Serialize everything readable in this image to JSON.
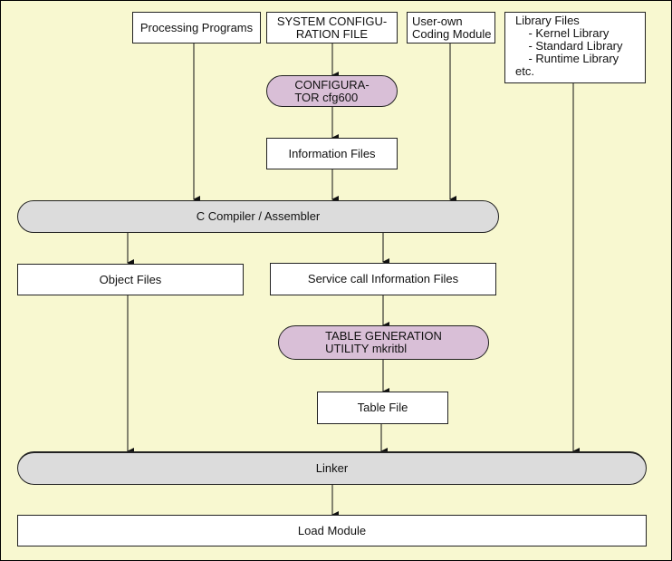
{
  "diagram": {
    "nodes": {
      "processing_programs": "Processing Programs",
      "system_config_file": "SYSTEM CONFIGU-\nRATION FILE",
      "user_own_module": "User-own\nCoding Module",
      "library_files": "Library Files\n    - Kernel Library\n    - Standard Library\n    - Runtime Library\netc.",
      "configurator": "CONFIGURA-\nTOR cfg600",
      "information_files": "Information Files",
      "c_compiler": "C Compiler / Assembler",
      "object_files": "Object Files",
      "service_call_info_files": "Service call Information Files",
      "table_generation_utility": "TABLE GENERATION\nUTILITY mkritbl",
      "table_file": "Table File",
      "linker": "Linker",
      "load_module": "Load Module"
    },
    "edges": [
      [
        "system_config_file",
        "configurator"
      ],
      [
        "configurator",
        "information_files"
      ],
      [
        "processing_programs",
        "c_compiler"
      ],
      [
        "information_files",
        "c_compiler"
      ],
      [
        "user_own_module",
        "c_compiler"
      ],
      [
        "c_compiler",
        "object_files"
      ],
      [
        "c_compiler",
        "service_call_info_files"
      ],
      [
        "service_call_info_files",
        "table_generation_utility"
      ],
      [
        "table_generation_utility",
        "table_file"
      ],
      [
        "object_files",
        "linker"
      ],
      [
        "table_file",
        "linker"
      ],
      [
        "library_files",
        "linker"
      ],
      [
        "linker",
        "load_module"
      ]
    ],
    "colors": {
      "background": "#f8f8d0",
      "process_fill": "#d9bfd7",
      "tool_fill": "#dcdcdc",
      "file_fill": "#ffffff"
    }
  }
}
